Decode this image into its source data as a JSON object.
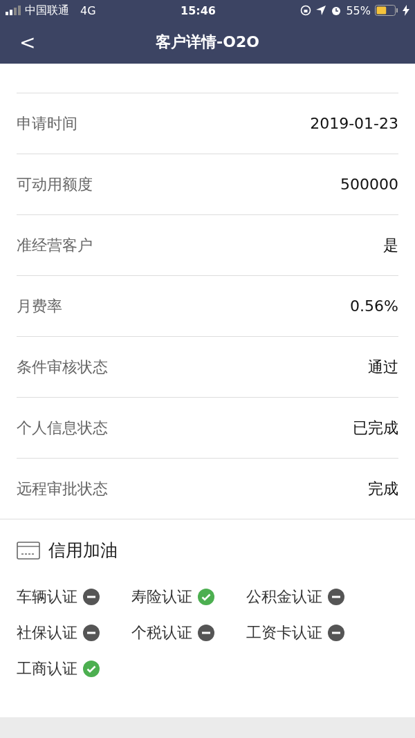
{
  "status_bar": {
    "carrier": "中国联通",
    "network": "4G",
    "time": "15:46",
    "battery": {
      "reading": "55%",
      "level": 0.55
    }
  },
  "header": {
    "back": "<",
    "title": "客户详情-O2O"
  },
  "fields": [
    {
      "label": "申请时间",
      "value": "2019-01-23"
    },
    {
      "label": "可动用额度",
      "value": "500000"
    },
    {
      "label": "准经营客户",
      "value": "是"
    },
    {
      "label": "月费率",
      "value": "0.56%"
    },
    {
      "label": "条件审核状态",
      "value": "通过"
    },
    {
      "label": "个人信息状态",
      "value": "已完成"
    },
    {
      "label": "远程审批状态",
      "value": "完成"
    }
  ],
  "section": {
    "title": "信用加油",
    "checks": [
      {
        "label": "车辆认证",
        "verified": false
      },
      {
        "label": "寿险认证",
        "verified": true
      },
      {
        "label": "公积金认证",
        "verified": false
      },
      {
        "label": "社保认证",
        "verified": false
      },
      {
        "label": "个税认证",
        "verified": false
      },
      {
        "label": "工资卡认证",
        "verified": false
      },
      {
        "label": "工商认证",
        "verified": true
      }
    ]
  }
}
